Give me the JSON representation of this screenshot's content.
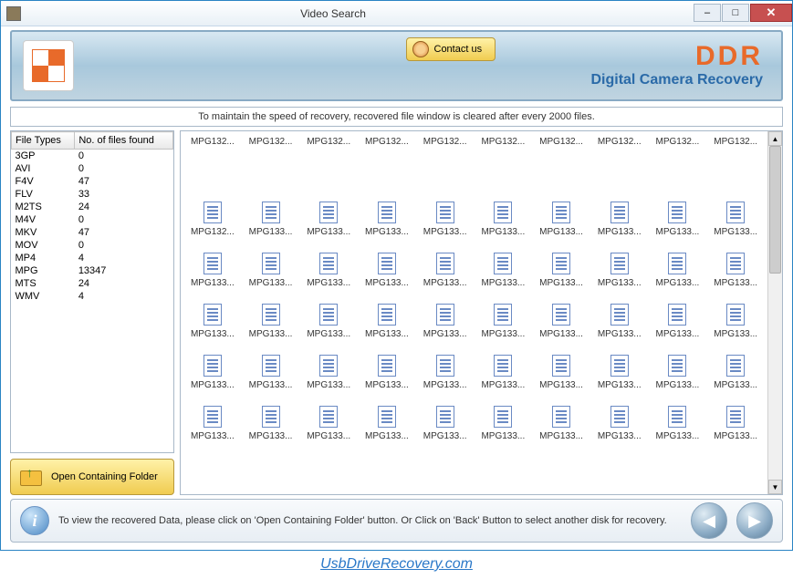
{
  "window": {
    "title": "Video Search",
    "minimize": "–",
    "maximize": "□",
    "close": "✕"
  },
  "banner": {
    "contact_label": "Contact us",
    "brand": "DDR",
    "subtitle": "Digital Camera Recovery"
  },
  "notice": "To maintain the speed of recovery, recovered file window is cleared after every 2000 files.",
  "table": {
    "headers": {
      "type": "File Types",
      "count": "No. of files found"
    },
    "rows": [
      {
        "type": "3GP",
        "count": 0
      },
      {
        "type": "AVI",
        "count": 0
      },
      {
        "type": "F4V",
        "count": 47
      },
      {
        "type": "FLV",
        "count": 33
      },
      {
        "type": "M2TS",
        "count": 24
      },
      {
        "type": "M4V",
        "count": 0
      },
      {
        "type": "MKV",
        "count": 47
      },
      {
        "type": "MOV",
        "count": 0
      },
      {
        "type": "MP4",
        "count": 4
      },
      {
        "type": "MPG",
        "count": 13347
      },
      {
        "type": "MTS",
        "count": 24
      },
      {
        "type": "WMV",
        "count": 4
      }
    ]
  },
  "open_folder_label": "Open Containing Folder",
  "files": {
    "row1": [
      "MPG132...",
      "MPG132...",
      "MPG132...",
      "MPG132...",
      "MPG132...",
      "MPG132...",
      "MPG132...",
      "MPG132...",
      "MPG132...",
      "MPG132..."
    ],
    "row2": [
      "MPG132...",
      "MPG133...",
      "MPG133...",
      "MPG133...",
      "MPG133...",
      "MPG133...",
      "MPG133...",
      "MPG133...",
      "MPG133...",
      "MPG133..."
    ],
    "row3": [
      "MPG133...",
      "MPG133...",
      "MPG133...",
      "MPG133...",
      "MPG133...",
      "MPG133...",
      "MPG133...",
      "MPG133...",
      "MPG133...",
      "MPG133..."
    ],
    "row4": [
      "MPG133...",
      "MPG133...",
      "MPG133...",
      "MPG133...",
      "MPG133...",
      "MPG133...",
      "MPG133...",
      "MPG133...",
      "MPG133...",
      "MPG133..."
    ],
    "row5": [
      "MPG133...",
      "MPG133...",
      "MPG133...",
      "MPG133...",
      "MPG133...",
      "MPG133...",
      "MPG133...",
      "MPG133...",
      "MPG133...",
      "MPG133..."
    ],
    "row6": [
      "MPG133...",
      "MPG133...",
      "MPG133...",
      "MPG133...",
      "MPG133...",
      "MPG133...",
      "MPG133...",
      "MPG133...",
      "MPG133...",
      "MPG133..."
    ]
  },
  "footer": {
    "text": "To view the recovered Data, please click on 'Open Containing Folder' button. Or Click on 'Back' Button to select another disk for recovery.",
    "back": "◀",
    "next": "▶"
  },
  "site_link": "UsbDriveRecovery.com"
}
